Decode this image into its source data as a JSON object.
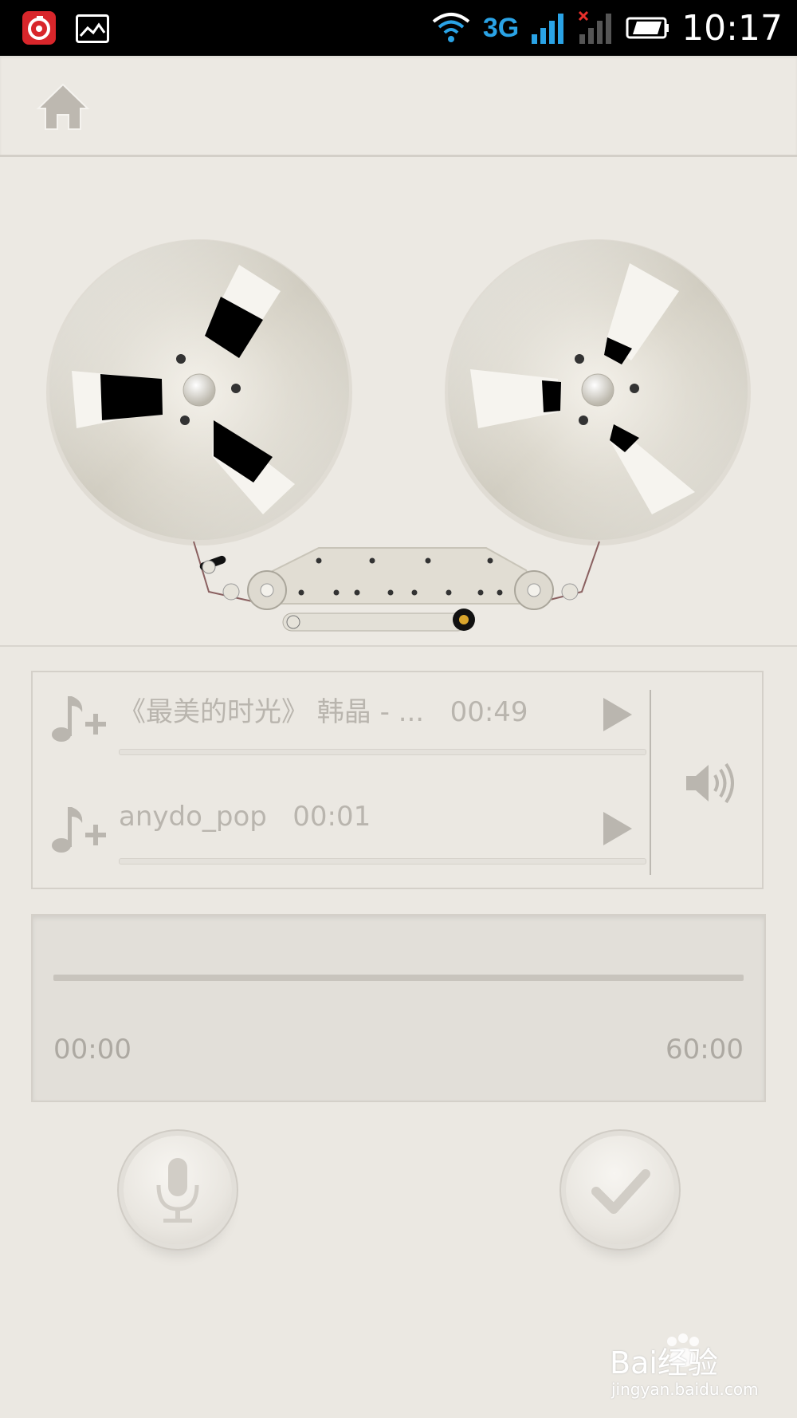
{
  "status_bar": {
    "network_type": "3G",
    "time": "10:17"
  },
  "header": {
    "home_icon": "home-icon"
  },
  "tracks": [
    {
      "title": "《最美的时光》 韩晶 - ...",
      "duration": "00:49",
      "add_icon": "music-add-icon",
      "play_icon": "play-icon"
    },
    {
      "title": "anydo_pop",
      "duration": "00:01",
      "add_icon": "music-add-icon",
      "play_icon": "play-icon"
    }
  ],
  "timeline": {
    "start_time": "00:00",
    "end_time": "60:00"
  },
  "controls": {
    "record_icon": "microphone-icon",
    "confirm_icon": "checkmark-icon",
    "volume_icon": "speaker-icon"
  },
  "watermark": {
    "brand": "Bai经验",
    "url": "jingyan.baidu.com"
  },
  "colors": {
    "background": "#ebe8e2",
    "status_bar": "#000000",
    "accent_3g": "#2aa3e6",
    "muted_text": "#b9b5ae"
  }
}
